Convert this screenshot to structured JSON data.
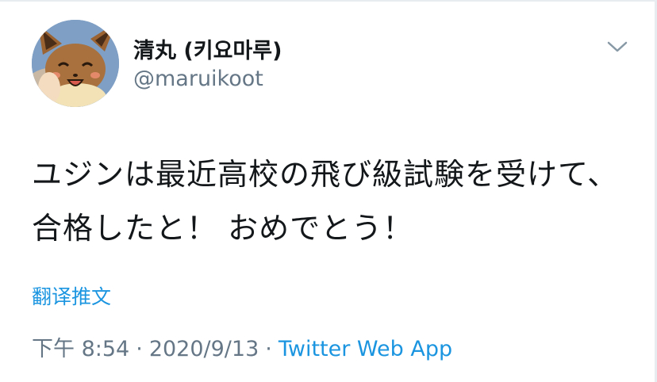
{
  "user": {
    "display_name": "清丸 (키요마루)",
    "handle": "@maruikoot"
  },
  "tweet": {
    "text": "ユジンは最近高校の飛び級試験を受けて、合格したと！ おめでとう！",
    "translate_label": "翻译推文",
    "time": "下午 8:54",
    "separator": "·",
    "date": "2020/9/13",
    "source": "Twitter Web App"
  },
  "icons": {
    "avatar": "eevee-avatar",
    "menu": "chevron-down-icon"
  },
  "colors": {
    "text": "#14171a",
    "secondary": "#657786",
    "link": "#1b95e0",
    "border": "#e6ecf0"
  }
}
